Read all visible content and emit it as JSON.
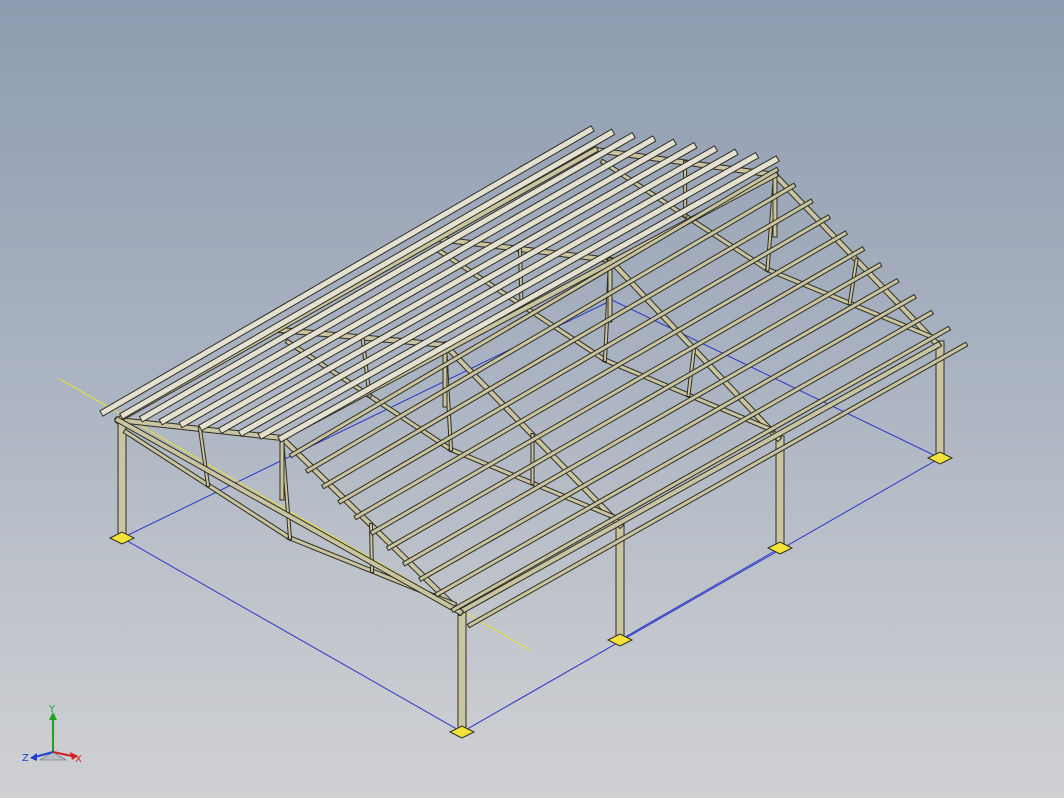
{
  "viewport": {
    "background_top": "#8e9bb0",
    "background_bottom": "#cfd0d2",
    "model": "steel-frame-shed",
    "steel_color": "#c9c4a2",
    "steel_edge_color": "#2e2e22",
    "purlin_color": "#e4e1d2",
    "baseplate_color": "#f2e23a",
    "sketch_line_color": "#2b35c8",
    "centerline_color": "#e8e030"
  },
  "triad": {
    "x_label": "X",
    "y_label": "Y",
    "z_label": "Z",
    "x_color": "#d42020",
    "y_color": "#20a020",
    "z_color": "#2040d0",
    "icon": "axis-triad-icon"
  }
}
